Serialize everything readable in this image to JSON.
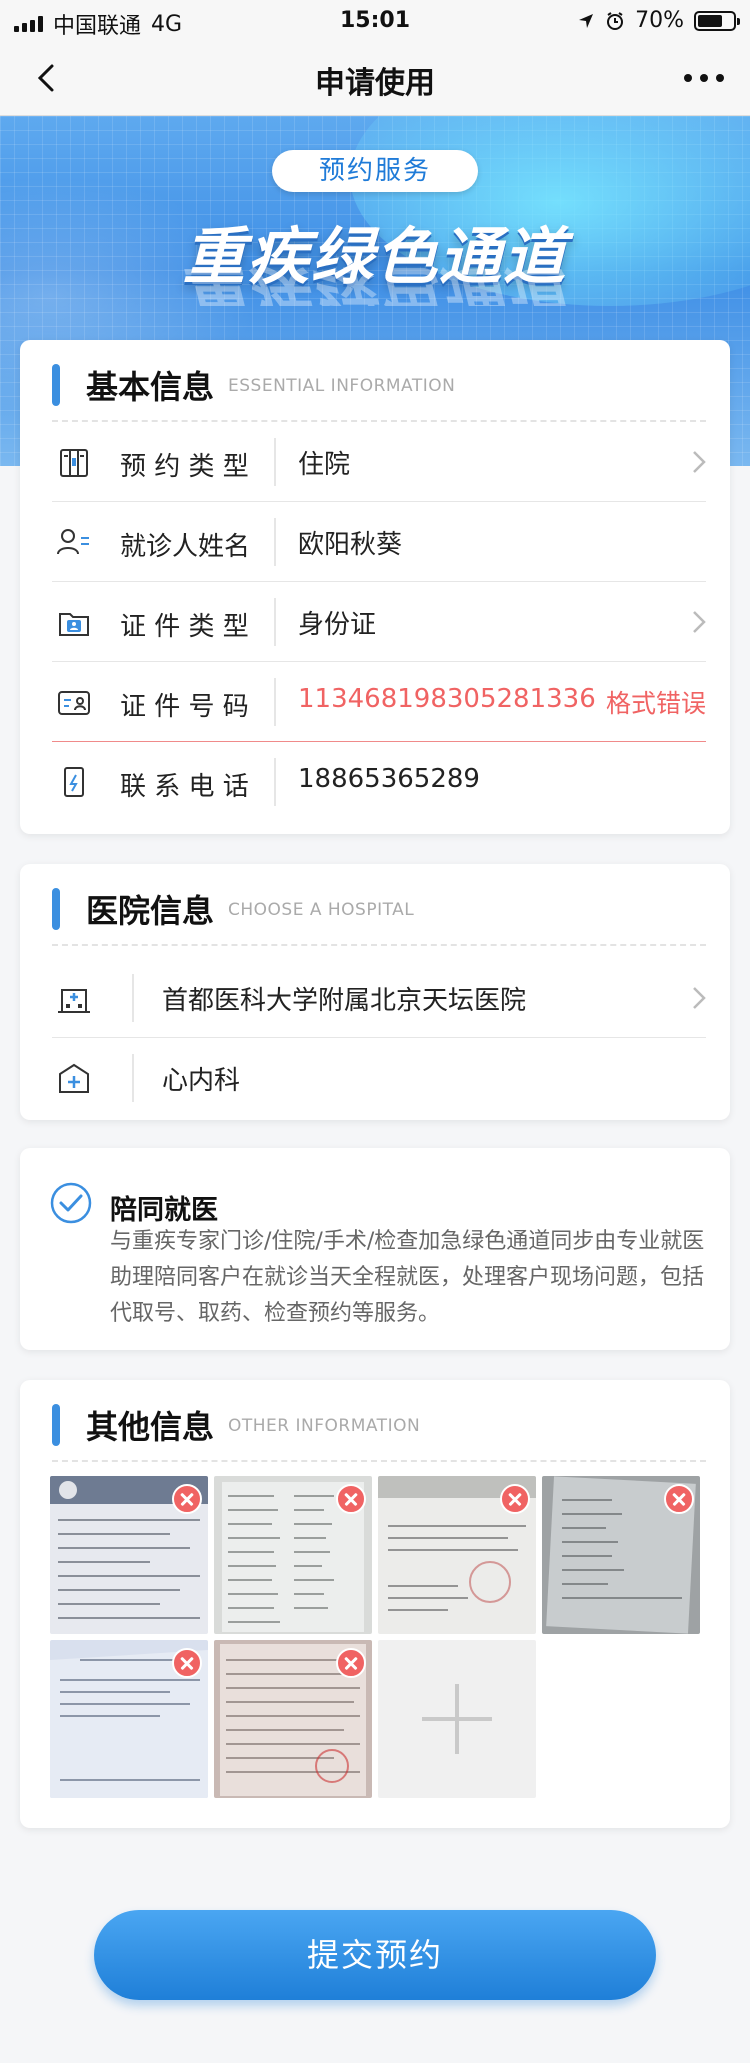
{
  "status_bar": {
    "carrier": "中国联通",
    "network": "4G",
    "time": "15:01",
    "battery": "70%",
    "battery_level": 0.7
  },
  "nav": {
    "title": "申请使用"
  },
  "banner": {
    "badge": "预约服务",
    "headline": "重疾绿色通道"
  },
  "basic_info": {
    "title": "基本信息",
    "subtitle": "ESSENTIAL INFORMATION",
    "rows": [
      {
        "label": "预 约 类 型",
        "value": "住院"
      },
      {
        "label": "就诊人姓名",
        "value": "欧阳秋葵"
      },
      {
        "label": "证 件 类 型",
        "value": "身份证"
      },
      {
        "label": "证 件 号 码",
        "value": "113468198305281336",
        "error": "格式错误"
      },
      {
        "label": "联 系 电 话",
        "value": "18865365289"
      }
    ]
  },
  "hospital_info": {
    "title": "医院信息",
    "subtitle": "CHOOSE A HOSPITAL",
    "hospital": "首都医科大学附属北京天坛医院",
    "department": "心内科"
  },
  "accompany": {
    "title": "陪同就医",
    "description": "与重疾专家门诊/住院/手术/检查加急绿色通道同步由专业就医助理陪同客户在就诊当天全程就医，处理客户现场问题，包括代取号、取药、检查预约等服务。"
  },
  "other_info": {
    "title": "其他信息",
    "subtitle": "OTHER INFORMATION",
    "photo_count": 6
  },
  "submit_label": "提交预约",
  "colors": {
    "accent": "#3b8fe0",
    "error": "#f06363"
  }
}
